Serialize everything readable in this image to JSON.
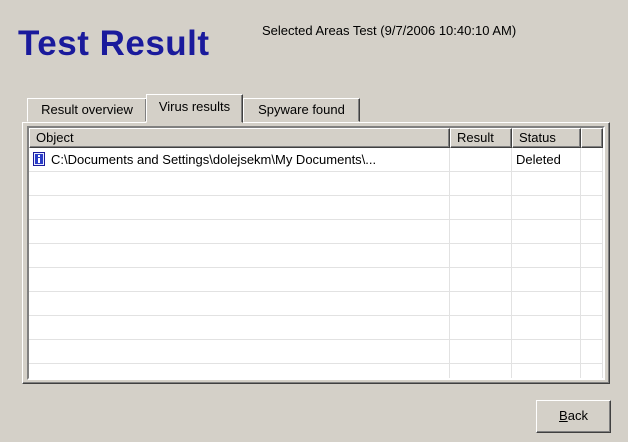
{
  "header": {
    "title": "Test Result",
    "subtitle": "Selected Areas Test (9/7/2006 10:40:10 AM)"
  },
  "tabs": [
    {
      "label": "Result overview",
      "active": false
    },
    {
      "label": "Virus results",
      "active": true
    },
    {
      "label": "Spyware found",
      "active": false
    }
  ],
  "table": {
    "columns": [
      "Object",
      "Result",
      "Status"
    ],
    "rows": [
      {
        "icon": "info-file-icon",
        "object": "C:\\Documents and Settings\\dolejsekm\\My Documents\\...",
        "result": "",
        "status": "Deleted"
      }
    ]
  },
  "buttons": {
    "back_mnemonic": "B",
    "back_rest": "ack"
  },
  "colors": {
    "title": "#1a1a9c",
    "window_bg": "#d4d0c8"
  }
}
